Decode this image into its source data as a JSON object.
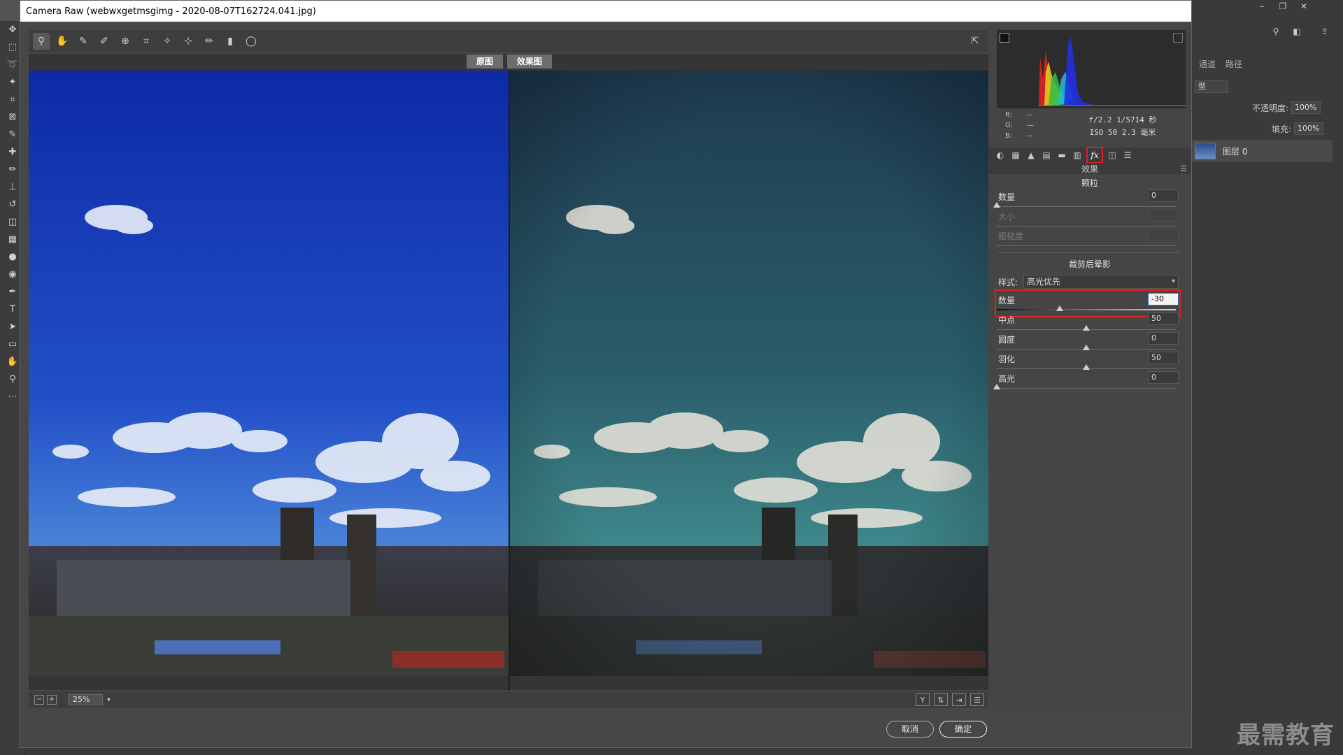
{
  "window": {
    "title": "Camera Raw (webwxgetmsgimg - 2020-08-07T162724.041.jpg)"
  },
  "preview": {
    "before_label": "原图",
    "after_label": "效果图",
    "zoom": "25%"
  },
  "histogram": {
    "rgb": {
      "r_label": "R:",
      "g_label": "G:",
      "b_label": "B:",
      "r": "—",
      "g": "—",
      "b": "—"
    },
    "exif_line1": "f/2.2  1/5714 秒",
    "exif_line2": "ISO 50  2.3 毫米"
  },
  "panel": {
    "title": "效果",
    "grain": {
      "title": "颗粒",
      "amount_label": "数量",
      "amount": "0",
      "amount_level": 0,
      "size_label": "大小",
      "roughness_label": "粗糙度"
    },
    "vignette": {
      "title": "裁剪后晕影",
      "style_label": "样式:",
      "style_value": "高光优先",
      "amount_label": "数量",
      "amount": "-30",
      "amount_level": 0.35,
      "midpoint_label": "中点",
      "midpoint": "50",
      "midpoint_level": 0.5,
      "roundness_label": "圆度",
      "roundness": "0",
      "roundness_level": 0.5,
      "feather_label": "羽化",
      "feather": "50",
      "feather_level": 0.5,
      "highlights_label": "高光",
      "highlights": "0",
      "highlights_level": 0
    }
  },
  "buttons": {
    "cancel": "取消",
    "ok": "确定"
  },
  "ps": {
    "tab_channels": "通道",
    "tab_paths": "路径",
    "opacity_label": "不透明度:",
    "opacity": "100%",
    "fill_label": "填充:",
    "fill": "100%",
    "layer_name": "图层 0",
    "kind_label": "型",
    "watermark": "最需教育"
  },
  "colors": {
    "highlight": "#e02020",
    "accent_blue": "#2d6fd0"
  }
}
